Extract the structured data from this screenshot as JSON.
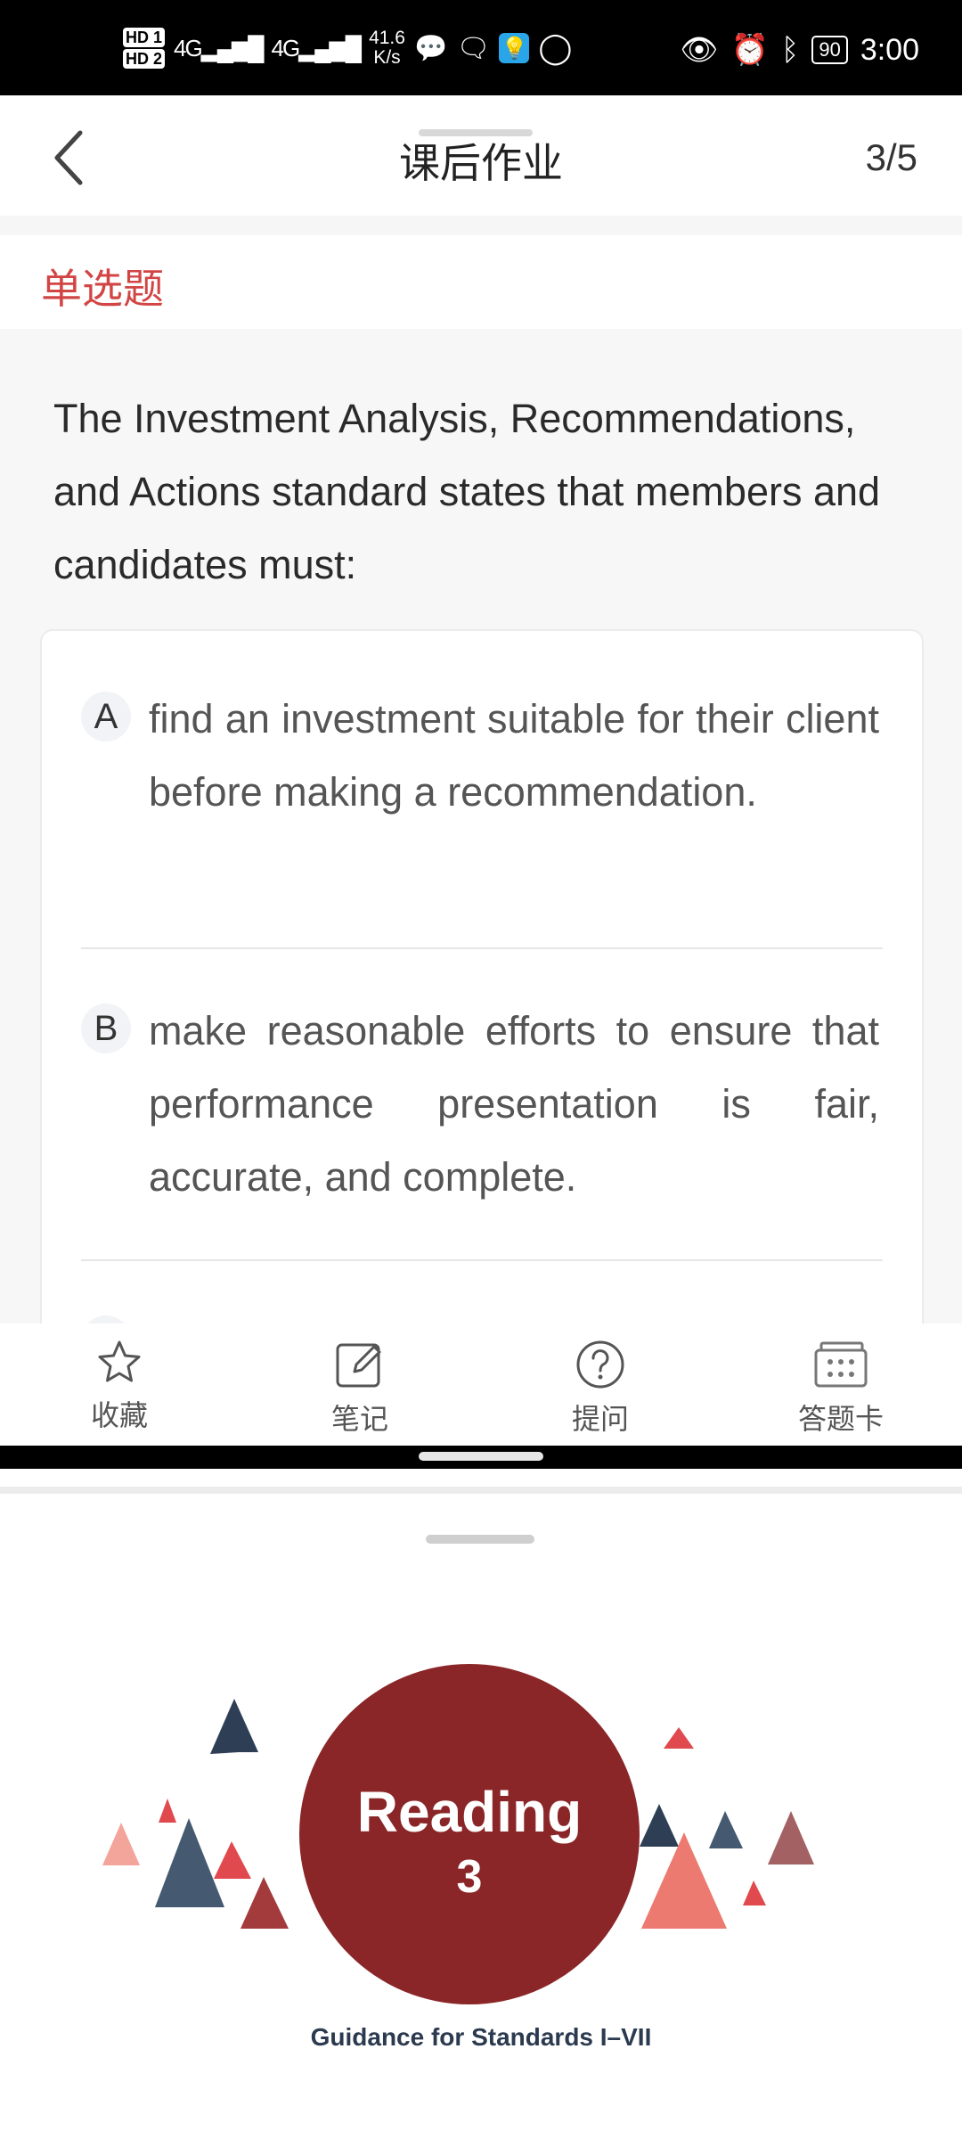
{
  "status_bar": {
    "hd1": "HD 1",
    "hd2": "HD 2",
    "signal1": "4G",
    "signal2": "4G",
    "speed_value": "41.6",
    "speed_unit": "K/s",
    "battery": "90",
    "time": "3:00"
  },
  "header": {
    "back_icon": "chevron-left-icon",
    "title": "课后作业",
    "counter": "3/5"
  },
  "question": {
    "type_label": "单选题",
    "text": "The Investment Analysis, Recommendations, and Actions standard states that members and candidates must:",
    "options": [
      {
        "letter": "A",
        "text": "find an investment suitable for their client before making a recommendation."
      },
      {
        "letter": "B",
        "text": "make reasonable efforts to ensure that performance presentation is fair, accurate, and complete."
      }
    ]
  },
  "toolbar": {
    "favorite_label": "收藏",
    "notes_label": "笔记",
    "ask_label": "提问",
    "answer_card_label": "答题卡"
  },
  "slide": {
    "circle_title": "Reading",
    "circle_number": "3",
    "subtitle": "Guidance for Standards I–VII",
    "colors": {
      "circle": "#8b2628",
      "navy": "#2e3f55",
      "red": "#e0494d",
      "salmon": "#ec7a71",
      "pink": "#f3a49b"
    }
  },
  "colors": {
    "accent_red": "#d24545"
  }
}
